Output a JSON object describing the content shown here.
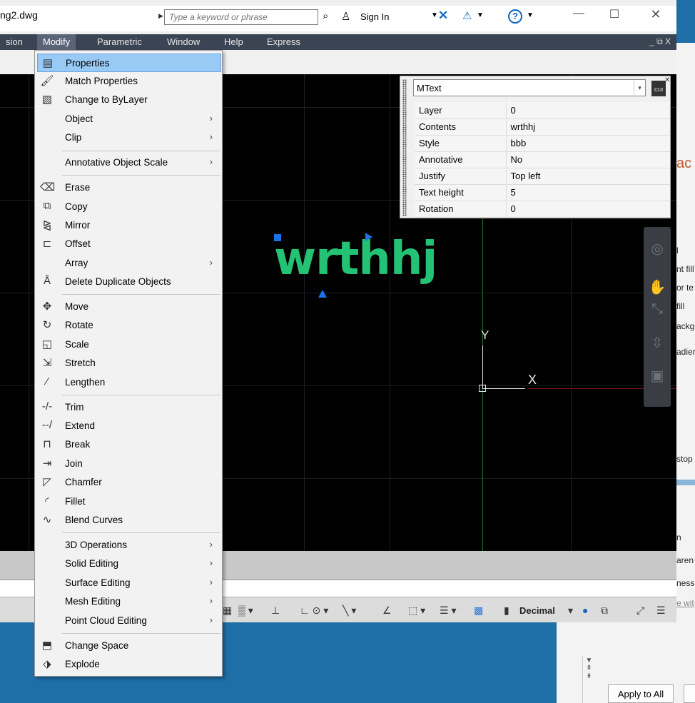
{
  "title_bar": {
    "doc_title": "ng2.dwg",
    "search_placeholder": "Type a keyword or phrase",
    "signin_label": "Sign In",
    "binoculars_icon": "binoculars-icon",
    "user_icon": "user-icon",
    "window_minimize": "—",
    "window_maximize": "☐",
    "window_close": "✕"
  },
  "menubar": {
    "items": [
      "sion",
      "Modify",
      "Parametric",
      "Window",
      "Help",
      "Express"
    ],
    "active": "Modify",
    "mdi_controls": "_ ⧉ X"
  },
  "modify_menu": {
    "items": [
      {
        "label": "Properties",
        "icon": "properties-icon",
        "highlighted": true
      },
      {
        "label": "Match Properties",
        "icon": "match-properties-icon"
      },
      {
        "label": "Change to ByLayer",
        "icon": "change-to-bylayer-icon"
      },
      {
        "label": "Object",
        "submenu": true
      },
      {
        "label": "Clip",
        "submenu": true
      },
      {
        "label": "Annotative Object Scale",
        "submenu": true
      },
      {
        "label": "Erase",
        "icon": "erase-icon"
      },
      {
        "label": "Copy",
        "icon": "copy-icon"
      },
      {
        "label": "Mirror",
        "icon": "mirror-icon"
      },
      {
        "label": "Offset",
        "icon": "offset-icon"
      },
      {
        "label": "Array",
        "submenu": true
      },
      {
        "label": "Delete Duplicate Objects",
        "icon": "delete-duplicates-icon"
      },
      {
        "label": "Move",
        "icon": "move-icon"
      },
      {
        "label": "Rotate",
        "icon": "rotate-icon"
      },
      {
        "label": "Scale",
        "icon": "scale-icon"
      },
      {
        "label": "Stretch",
        "icon": "stretch-icon"
      },
      {
        "label": "Lengthen",
        "icon": "lengthen-icon"
      },
      {
        "label": "Trim",
        "icon": "trim-icon"
      },
      {
        "label": "Extend",
        "icon": "extend-icon"
      },
      {
        "label": "Break",
        "icon": "break-icon"
      },
      {
        "label": "Join",
        "icon": "join-icon"
      },
      {
        "label": "Chamfer",
        "icon": "chamfer-icon"
      },
      {
        "label": "Fillet",
        "icon": "fillet-icon"
      },
      {
        "label": "Blend Curves",
        "icon": "blend-curves-icon"
      },
      {
        "label": "3D Operations",
        "submenu": true
      },
      {
        "label": "Solid Editing",
        "submenu": true
      },
      {
        "label": "Surface Editing",
        "submenu": true
      },
      {
        "label": "Mesh Editing",
        "submenu": true
      },
      {
        "label": "Point Cloud Editing",
        "submenu": true
      },
      {
        "label": "Change Space",
        "icon": "change-space-icon"
      },
      {
        "label": "Explode",
        "icon": "explode-icon"
      }
    ]
  },
  "quick_properties": {
    "object_type": "MText",
    "cui_label": "CUI",
    "rows": [
      {
        "key": "Layer",
        "value": "0"
      },
      {
        "key": "Contents",
        "value": "wrthhj"
      },
      {
        "key": "Style",
        "value": "bbb"
      },
      {
        "key": "Annotative",
        "value": "No"
      },
      {
        "key": "Justify",
        "value": "Top left"
      },
      {
        "key": "Text height",
        "value": "5"
      },
      {
        "key": "Rotation",
        "value": "0"
      }
    ]
  },
  "canvas": {
    "text_object": "wrthhj",
    "ucs_x": "X",
    "ucs_y": "Y"
  },
  "statusbar": {
    "units": "Decimal"
  },
  "background_app": {
    "accent_text": "ac",
    "partial_texts": [
      "l",
      "nt fill",
      "or te",
      "fill",
      "ackgr",
      "adien",
      "stop",
      "n",
      "aren",
      "ness",
      "e wit"
    ],
    "apply_button": "Apply to All"
  }
}
